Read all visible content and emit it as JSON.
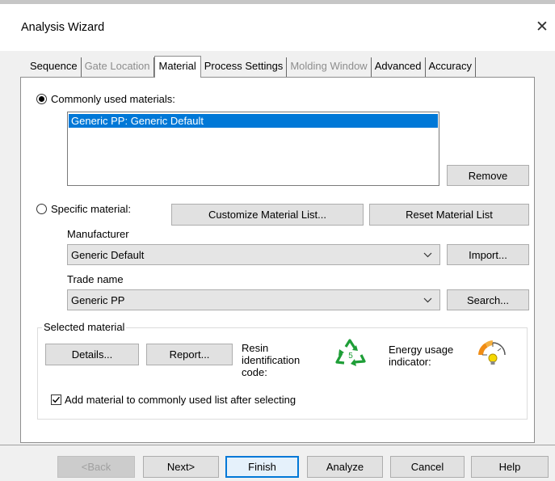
{
  "window": {
    "title": "Analysis Wizard",
    "close_glyph": "✕"
  },
  "tabs": [
    {
      "label": "Sequence",
      "state": "normal"
    },
    {
      "label": "Gate Location",
      "state": "disabled"
    },
    {
      "label": "Material",
      "state": "active"
    },
    {
      "label": "Process Settings",
      "state": "normal"
    },
    {
      "label": "Molding Window",
      "state": "disabled"
    },
    {
      "label": "Advanced",
      "state": "normal"
    },
    {
      "label": "Accuracy",
      "state": "normal"
    }
  ],
  "common": {
    "radio_label": "Commonly used materials:",
    "selected": true,
    "list_items": [
      "Generic PP: Generic Default"
    ],
    "remove_label": "Remove"
  },
  "specific": {
    "radio_label": "Specific material:",
    "selected": false,
    "customize_label": "Customize Material List...",
    "reset_label": "Reset Material List",
    "manufacturer_label": "Manufacturer",
    "manufacturer_value": "Generic Default",
    "import_label": "Import...",
    "trade_label": "Trade name",
    "trade_value": "Generic PP",
    "search_label": "Search..."
  },
  "selected_material": {
    "group_label": "Selected material",
    "details_label": "Details...",
    "report_label": "Report...",
    "resin_line1": "Resin",
    "resin_line2": "identification",
    "resin_line3": "code:",
    "resin_code": "5",
    "energy_line1": "Energy usage",
    "energy_line2": "indicator:",
    "add_checkbox_label": "Add material to commonly used list after selecting",
    "add_checked": true
  },
  "footer": {
    "back_label": "<Back",
    "next_label": "Next>",
    "finish_label": "Finish",
    "analyze_label": "Analyze",
    "cancel_label": "Cancel",
    "help_label": "Help"
  },
  "colors": {
    "selection": "#0078d7",
    "recycle_green": "#1e9e37",
    "gauge_orange": "#f08c14",
    "bulb_yellow": "#f5d800"
  },
  "icons": {
    "close": "close-icon",
    "dropdown": "chevron-down-icon",
    "resin": "recycle-icon",
    "energy": "energy-gauge-icon",
    "check": "checkmark-icon"
  }
}
